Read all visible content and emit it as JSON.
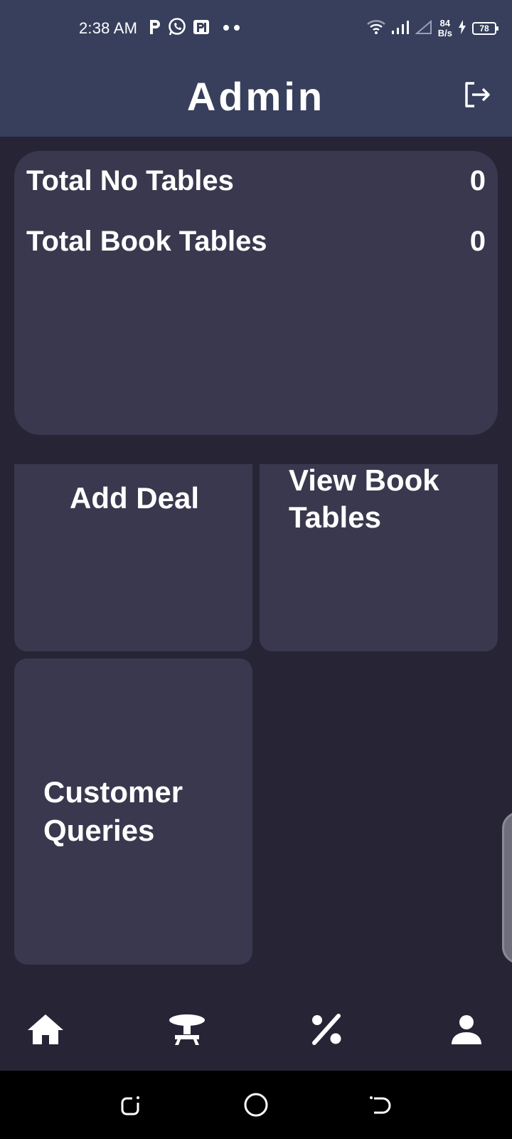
{
  "status_bar": {
    "time": "2:38 AM",
    "net_speed_value": "84",
    "net_speed_unit": "B/s",
    "battery_level": "78",
    "icons": [
      "parking-p-icon",
      "whatsapp-icon",
      "parking-app-icon",
      "more-dots-icon",
      "wifi-icon",
      "signal-icon",
      "signal-empty-icon",
      "charging-icon",
      "battery-icon"
    ]
  },
  "header": {
    "title": "Admin",
    "logout_icon": "logout-icon"
  },
  "summary": {
    "rows": [
      {
        "label": "Total No Tables",
        "value": "0"
      },
      {
        "label": "Total Book Tables",
        "value": "0"
      }
    ]
  },
  "tiles": {
    "add_deal": "Add Deal",
    "view_book_tables_line1": "View Book",
    "view_book_tables_line2": "Tables",
    "customer_queries_line1": "Customer",
    "customer_queries_line2": "Queries"
  },
  "bottom_nav": {
    "items": [
      "home-icon",
      "table-icon",
      "percent-icon",
      "person-icon"
    ]
  },
  "system_nav": {
    "items": [
      "recents-icon",
      "home-circle-icon",
      "back-icon"
    ]
  },
  "colors": {
    "header_bg": "#373f5c",
    "page_bg": "#262435",
    "card_bg": "#3a384e",
    "text": "#ffffff"
  }
}
